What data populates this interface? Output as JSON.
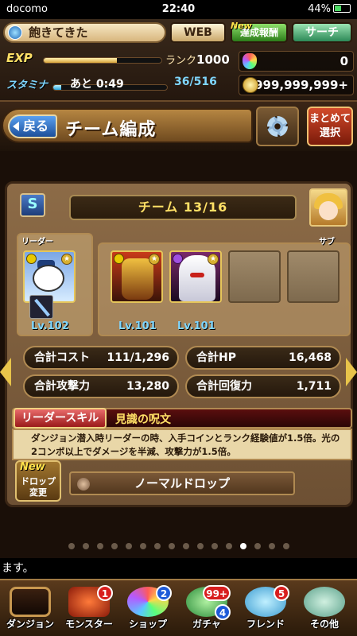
{
  "status": {
    "carrier": "docomo",
    "time": "22:40",
    "battery": "44%"
  },
  "hud": {
    "player_name": "飽きてきた",
    "web_label": "WEB",
    "reward_label": "達成報酬",
    "reward_new": "New",
    "search_label": "サーチ",
    "exp_label": "EXP",
    "exp_progress": 0.62,
    "rank_label": "ランク",
    "rank_value": "1000",
    "stamina_label": "スタミナ",
    "stamina_timer": "あと 0:49",
    "stamina_value": "36/516",
    "stamina_progress": 0.07,
    "magic_stones": "0",
    "coins": "999,999,999+"
  },
  "page": {
    "back_label": "戻る",
    "title": "チーム編成",
    "bulk_select_label_1": "まとめて",
    "bulk_select_label_2": "選択"
  },
  "team": {
    "name": "チーム 13/16",
    "leader_tag": "リーダー",
    "sub_tag": "サブ",
    "leader_level": "Lv.102",
    "member_levels": [
      "Lv.101",
      "Lv.101"
    ],
    "stats": {
      "cost_label": "合計コスト",
      "cost_value": "111/1,296",
      "hp_label": "合計HP",
      "hp_value": "16,468",
      "atk_label": "合計攻撃力",
      "atk_value": "13,280",
      "rcv_label": "合計回復力",
      "rcv_value": "1,711"
    },
    "leader_skill_tag": "リーダースキル",
    "leader_skill_name": "見識の呪文",
    "leader_skill_desc": "ダンジョン潜入時リーダーの時、入手コインとランク経験値が1.5倍。光の2コンボ以上でダメージを半減、攻撃力が1.5倍。",
    "drop_new": "New",
    "drop_change_label_1": "ドロップ",
    "drop_change_label_2": "変更",
    "drop_select": "ノーマルドロップ"
  },
  "ticker": "ます。",
  "nav": [
    {
      "label": "ダンジョン",
      "icon": "dungeon-icon"
    },
    {
      "label": "モンスター",
      "icon": "monster-icon",
      "badge": "1"
    },
    {
      "label": "ショップ",
      "icon": "shop-icon",
      "badge": "2"
    },
    {
      "label": "ガチャ",
      "icon": "gacha-icon",
      "badge": "99+",
      "badge2": "4"
    },
    {
      "label": "フレンド",
      "icon": "friend-icon",
      "badge": "5"
    },
    {
      "label": "その他",
      "icon": "other-icon"
    }
  ],
  "pager": {
    "total": 16,
    "active": 13
  }
}
